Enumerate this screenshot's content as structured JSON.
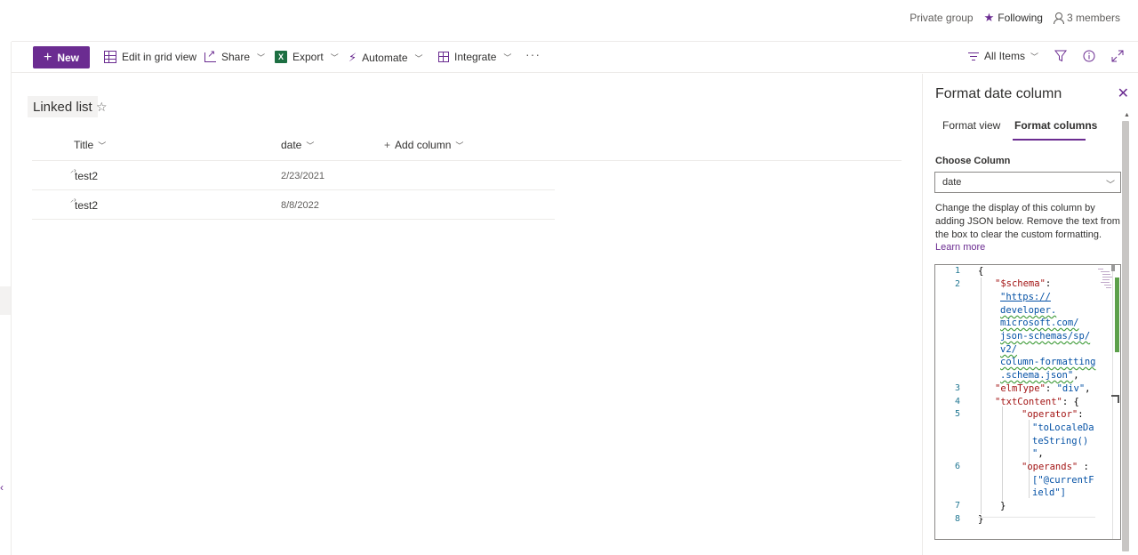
{
  "topbar": {
    "privacy": "Private group",
    "following": "Following",
    "members": "3 members"
  },
  "commandbar": {
    "new_label": "New",
    "edit_grid_label": "Edit in grid view",
    "share_label": "Share",
    "export_label": "Export",
    "automate_label": "Automate",
    "integrate_label": "Integrate",
    "more_label": "···",
    "view_label": "All Items"
  },
  "list": {
    "title": "Linked list",
    "columns": {
      "title": "Title",
      "date": "date",
      "add": "Add column"
    },
    "rows": [
      {
        "title": "test2",
        "date": "2/23/2021"
      },
      {
        "title": "test2",
        "date": "8/8/2022"
      }
    ]
  },
  "panel": {
    "title": "Format date column",
    "tabs": [
      "Format view",
      "Format columns"
    ],
    "active_tab": "Format columns",
    "choose_label": "Choose Column",
    "selected_column": "date",
    "description": "Change the display of this column by adding JSON below. Remove the text from the box to clear the custom formatting.",
    "learn_more": "Learn more"
  },
  "editor": {
    "line_numbers": [
      "1",
      "2",
      "3",
      "4",
      "5",
      "6",
      "7",
      "8"
    ],
    "lines": {
      "l1": "{",
      "schema_key": "\"$schema\"",
      "schema_url": [
        "\"https://",
        "developer.",
        "microsoft.com/",
        "json-schemas/sp/",
        "v2/",
        "column-formatting",
        ".schema.json\""
      ],
      "elm_key": "\"elmType\"",
      "elm_val": "\"div\"",
      "txt_key": "\"txtContent\"",
      "op_key": "\"operator\"",
      "op_val": [
        "\"toLocaleDa",
        "teString()",
        "\""
      ],
      "operands_key": "\"operands\"",
      "operands_val": [
        "[\"@currentF",
        "ield\"]"
      ],
      "close_inner": "}",
      "close_outer": "}"
    }
  },
  "colors": {
    "accent": "#6b2c91",
    "link": "#0451a5",
    "json_key": "#a31515",
    "line_number": "#237893"
  }
}
